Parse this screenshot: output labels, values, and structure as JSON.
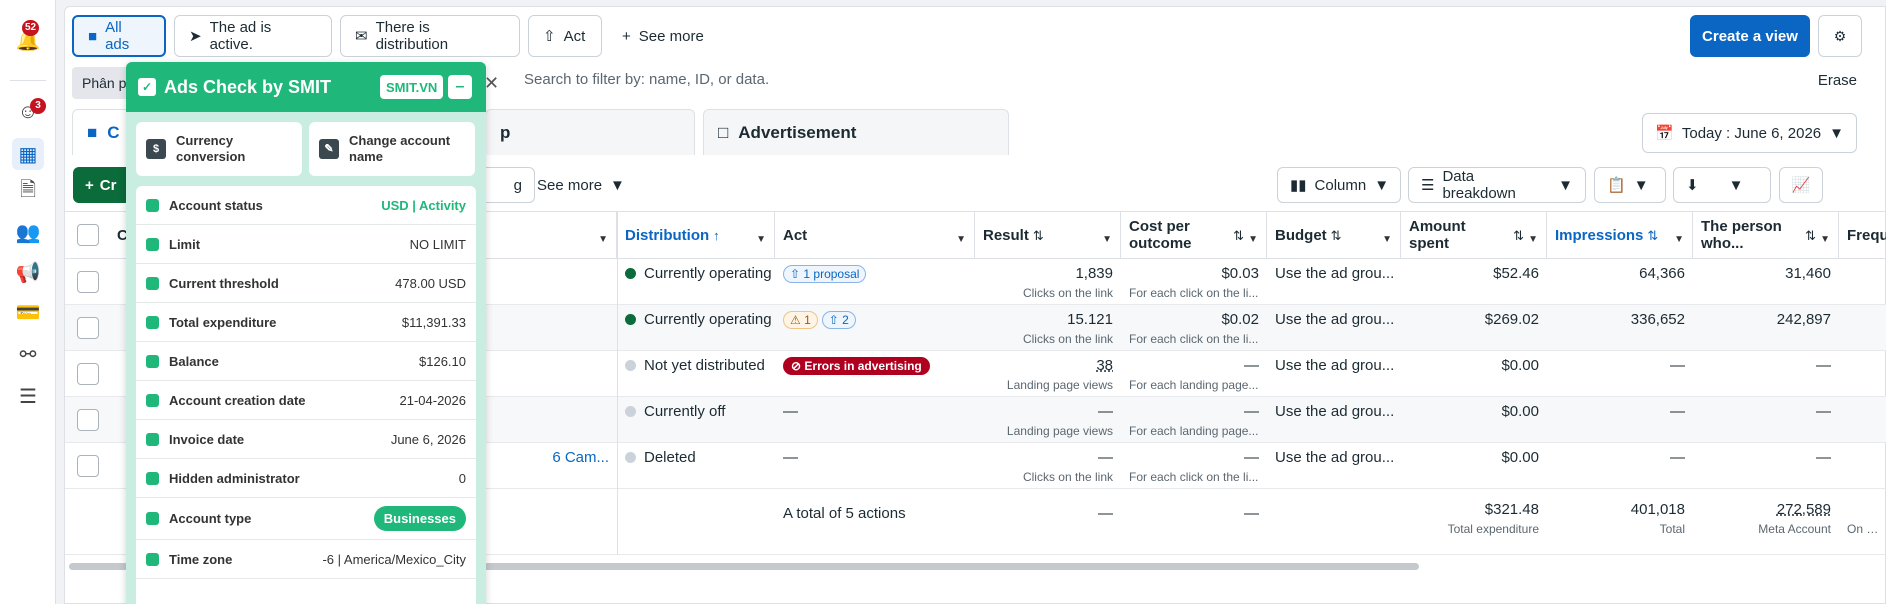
{
  "rail": {
    "notifications_badge": "52",
    "support_badge": "3"
  },
  "topbar": {
    "chips": [
      "All ads",
      "The ad is active.",
      "There is distribution",
      "Act"
    ],
    "see_more": "See more",
    "create_view": "Create a view"
  },
  "search": {
    "filter_chip": "Phân p",
    "placeholder": "Search to filter by: name, ID, or data.",
    "erase": "Erase"
  },
  "tabs": {
    "campaign_partial": "C",
    "adset_partial": "p",
    "advertisement": "Advertisement",
    "date": "Today : June 6, 2026"
  },
  "toolbar": {
    "create_partial": "Cr",
    "g_partial": "g",
    "see_more": "See more",
    "column": "Column",
    "data_breakdown": "Data breakdown"
  },
  "table": {
    "headers": {
      "c": "C",
      "distribution": "Distribution",
      "act": "Act",
      "result": "Result",
      "cost_per_outcome": "Cost per outcome",
      "budget": "Budget",
      "amount_spent": "Amount spent",
      "impressions": "Impressions",
      "reach": "The person who...",
      "frequency": "Frequency"
    },
    "rows": [
      {
        "name": "",
        "distribution": "Currently operating",
        "dot": "green",
        "act_pills": [
          "1 proposal"
        ],
        "result": "1,839",
        "result_sub": "Clicks on the link",
        "cost": "$0.03",
        "cost_sub": "For each click on the li...",
        "budget": "Use the ad grou...",
        "spent": "$52.46",
        "impressions": "64,366",
        "reach": "31,460"
      },
      {
        "name": "",
        "distribution": "Currently operating",
        "dot": "green",
        "act_warn": "1",
        "act_pills": [
          "2"
        ],
        "result": "15.121",
        "result_sub": "Clicks on the link",
        "cost": "$0.02",
        "cost_sub": "For each click on the li...",
        "budget": "Use the ad grou...",
        "spent": "$269.02",
        "impressions": "336,652",
        "reach": "242,897"
      },
      {
        "name": "",
        "distribution": "Not yet distributed",
        "dot": "grey",
        "act_error": "Errors in advertising",
        "result": "38",
        "result_sub": "Landing page views",
        "cost": "—",
        "cost_sub": "For each landing page...",
        "budget": "Use the ad grou...",
        "spent": "$0.00",
        "impressions": "—",
        "reach": "—"
      },
      {
        "name": "",
        "distribution": "Currently off",
        "dot": "grey",
        "act_text": "—",
        "result": "—",
        "result_sub": "Landing page views",
        "cost": "—",
        "cost_sub": "For each landing page...",
        "budget": "Use the ad grou...",
        "spent": "$0.00",
        "impressions": "—",
        "reach": "—"
      },
      {
        "name": "6 Cam...",
        "distribution": "Deleted",
        "dot": "grey",
        "act_text": "—",
        "result": "—",
        "result_sub": "Clicks on the link",
        "cost": "—",
        "cost_sub": "For each click on the li...",
        "budget": "Use the ad grou...",
        "spent": "$0.00",
        "impressions": "—",
        "reach": "—"
      }
    ],
    "totals": {
      "label": "A total of 5 actions",
      "result": "—",
      "cost": "—",
      "spent": "$321.48",
      "spent_sub": "Total expenditure",
      "impressions": "401,018",
      "impressions_sub": "Total",
      "reach": "272,589",
      "reach_sub": "Meta Account",
      "frequency_sub": "On each Meta"
    }
  },
  "panel": {
    "title": "Ads Check by SMIT",
    "tag": "SMIT.VN",
    "minimize": "–",
    "btn_currency": "Currency conversion",
    "btn_rename": "Change account name",
    "rows": [
      {
        "label": "Account status",
        "value": "USD | Activity",
        "style": "green"
      },
      {
        "label": "Limit",
        "value": "NO LIMIT",
        "style": ""
      },
      {
        "label": "Current threshold",
        "value": "478.00 USD",
        "style": ""
      },
      {
        "label": "Total expenditure",
        "value": "$11,391.33",
        "style": ""
      },
      {
        "label": "Balance",
        "value": "$126.10",
        "style": ""
      },
      {
        "label": "Account creation date",
        "value": "21-04-2026",
        "style": ""
      },
      {
        "label": "Invoice date",
        "value": "June 6, 2026",
        "style": ""
      },
      {
        "label": "Hidden administrator",
        "value": "0",
        "style": ""
      },
      {
        "label": "Account type",
        "value": "Businesses",
        "style": "pill-green"
      },
      {
        "label": "Time zone",
        "value": "-6 | America/Mexico_City",
        "style": ""
      }
    ]
  },
  "colors": {
    "primary": "#0a66c2",
    "create_green": "#0b6b3a",
    "smit_green": "#1fb87a",
    "error_red": "#b00020"
  }
}
